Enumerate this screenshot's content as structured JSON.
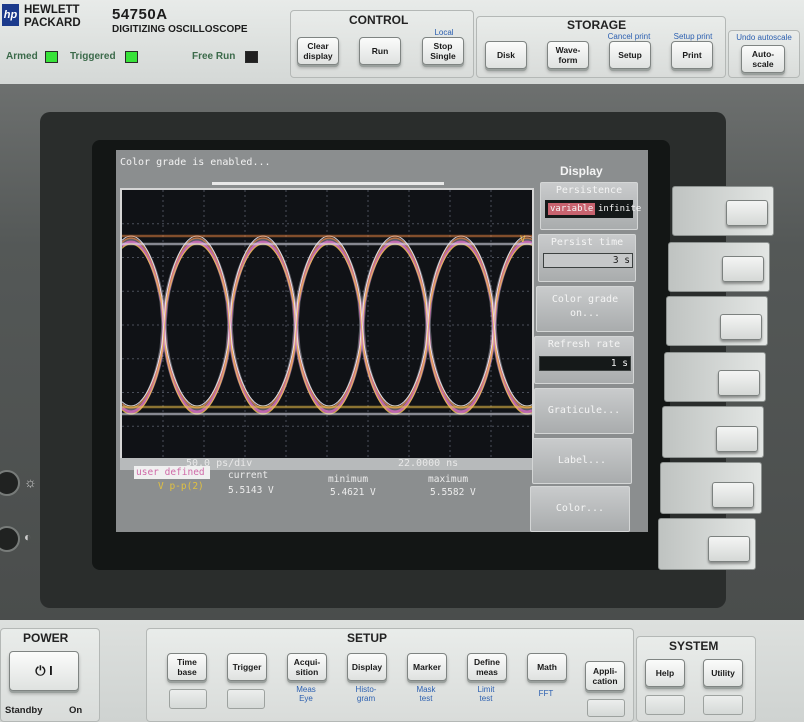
{
  "header": {
    "brand_line1": "HEWLETT",
    "brand_line2": "PACKARD",
    "model": "54750A",
    "model_subtitle": "DIGITIZING OSCILLOSCOPE",
    "indicators": [
      {
        "label": "Armed",
        "state": "on"
      },
      {
        "label": "Triggered",
        "state": "on"
      },
      {
        "label": "Free Run",
        "state": "off"
      }
    ]
  },
  "control": {
    "title": "CONTROL",
    "sub_label_local": "Local",
    "buttons": [
      {
        "label": "Clear\ndisplay"
      },
      {
        "label": "Run"
      },
      {
        "label": "Stop\nSingle"
      }
    ]
  },
  "storage": {
    "title": "STORAGE",
    "sub_labels": [
      "Cancel print",
      "Setup print"
    ],
    "buttons": [
      {
        "label": "Disk"
      },
      {
        "label": "Wave-\nform"
      },
      {
        "label": "Setup"
      },
      {
        "label": "Print"
      }
    ]
  },
  "autoscale": {
    "sub_label": "Undo autoscale",
    "label": "Auto-\nscale"
  },
  "screen": {
    "status_message": "Color grade is enabled...",
    "timebase_label": "50.0 ps/div",
    "time_position": "22.0000 ns",
    "right_marker": "V",
    "colors": {
      "trace_outer": "#e9e9f7",
      "trace_mid": "#d86ac0",
      "trace_hot": "#f0c34a",
      "trace_warm": "#e08040",
      "grid": "#4a4f5a"
    },
    "measurement": {
      "source_tab": "user defined",
      "measure_name": "V p-p(2)",
      "headers": [
        "current",
        "minimum",
        "maximum"
      ],
      "values": [
        "5.5143 V",
        "5.4621 V",
        "5.5582 V"
      ]
    },
    "menu": {
      "title": "Display",
      "persistence_label": "Persistence",
      "persistence_options": [
        "variable",
        "infinite"
      ],
      "persist_time_label": "Persist time",
      "persist_time_value": "3 s",
      "color_grade_label": "Color grade\non...",
      "refresh_rate_label": "Refresh rate",
      "refresh_rate_value": "1 s",
      "graticule_label": "Graticule...",
      "label_label": "Label...",
      "color_label": "Color..."
    }
  },
  "power": {
    "title": "POWER",
    "standby_label": "Standby",
    "on_label": "On",
    "switch_symbol": "⏻  I"
  },
  "setup": {
    "title": "SETUP",
    "buttons": [
      {
        "label": "Time\nbase",
        "below": ""
      },
      {
        "label": "Trigger",
        "below": ""
      },
      {
        "label": "Acqui-\nsition",
        "below": "Meas\nEye"
      },
      {
        "label": "Display",
        "below": "Histo-\ngram"
      },
      {
        "label": "Marker",
        "below": "Mask\ntest"
      },
      {
        "label": "Define\nmeas",
        "below": "Limit\ntest"
      },
      {
        "label": "Math",
        "below": "FFT"
      },
      {
        "label": "Appli-\ncation",
        "below": ""
      }
    ]
  },
  "system": {
    "title": "SYSTEM",
    "buttons": [
      {
        "label": "Help"
      },
      {
        "label": "Utility"
      }
    ]
  }
}
